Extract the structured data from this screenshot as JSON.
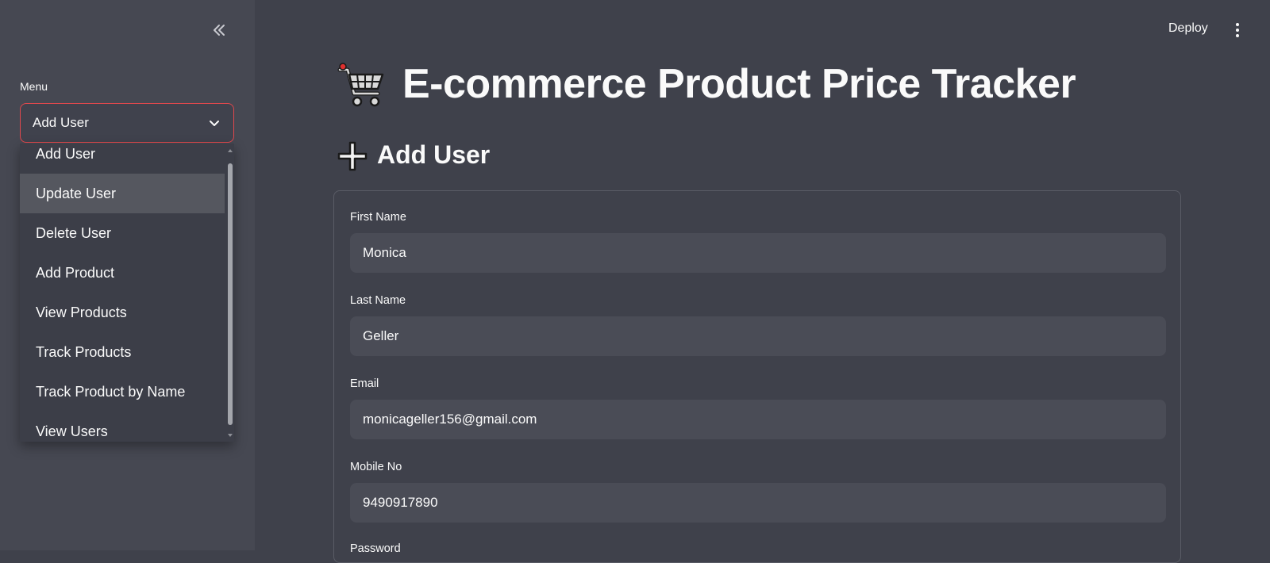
{
  "sidebar": {
    "collapse_icon": "double-chevron-left-icon",
    "menu_label": "Menu",
    "select": {
      "value": "Add User"
    },
    "dropdown": {
      "hovered_item": "Update User",
      "items": [
        "Add User",
        "Update User",
        "Delete User",
        "Add Product",
        "View Products",
        "Track Products",
        "Track Product by Name",
        "View Users"
      ]
    }
  },
  "header": {
    "deploy_label": "Deploy",
    "menu_icon": "kebab-menu-icon"
  },
  "main": {
    "title_icon": "shopping-cart-icon",
    "title": "E-commerce Product Price Tracker",
    "section_icon": "plus-icon",
    "section_title": "Add User",
    "form": {
      "fields": [
        {
          "label": "First Name",
          "value": "Monica"
        },
        {
          "label": "Last Name",
          "value": "Geller"
        },
        {
          "label": "Email",
          "value": "monicageller156@gmail.com"
        },
        {
          "label": "Mobile No",
          "value": "9490917890"
        },
        {
          "label": "Password",
          "value": ""
        }
      ]
    }
  },
  "colors": {
    "main_bg": "#3f414b",
    "sidebar_bg": "#464852",
    "focus_border": "#e0484d",
    "input_bg": "#4a4c56",
    "text": "#fafafa"
  }
}
